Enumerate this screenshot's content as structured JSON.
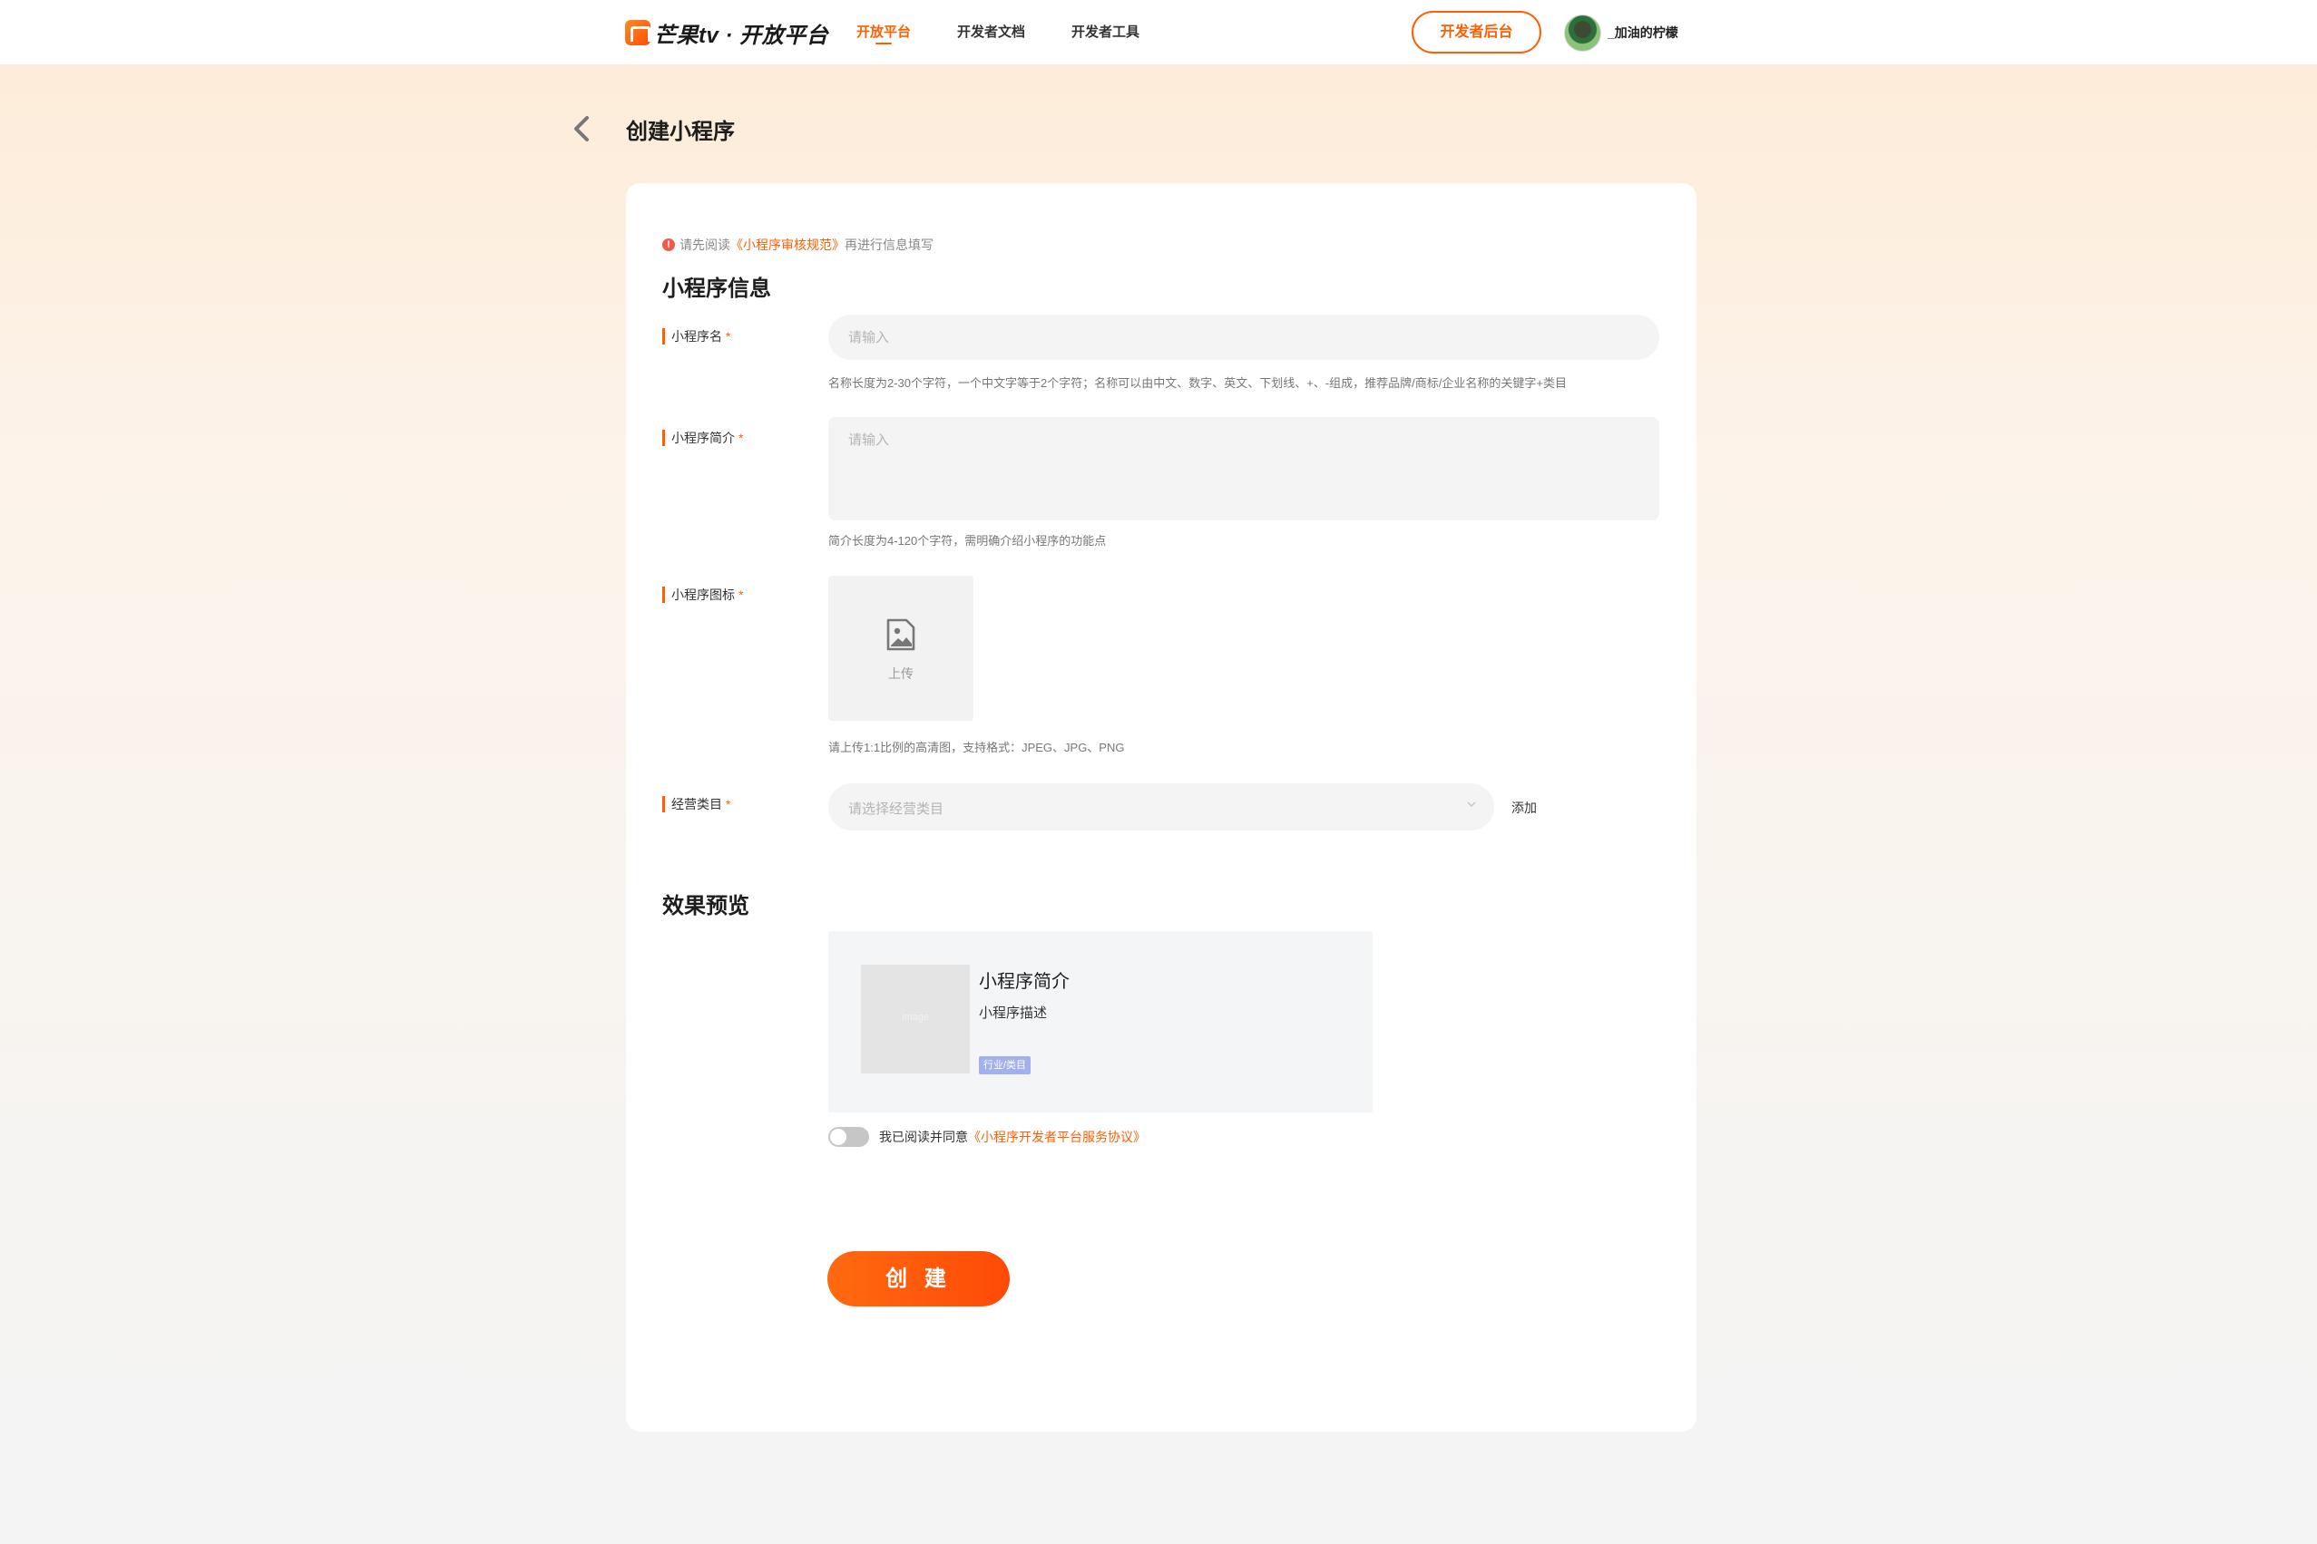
{
  "header": {
    "brand_text": "芒果tv · 开放平台",
    "nav": [
      {
        "label": "开放平台",
        "active": true
      },
      {
        "label": "开发者文档",
        "active": false
      },
      {
        "label": "开发者工具",
        "active": false
      }
    ],
    "console_button": "开发者后台",
    "username": "_加油的柠檬",
    "accent_color": "#ff5f00"
  },
  "page": {
    "title": "创建小程序",
    "back_icon": "chevron-left-icon"
  },
  "form": {
    "notice_prefix": "请先阅读",
    "notice_link": "《小程序审核规范》",
    "notice_suffix": "再进行信息填写",
    "section_info_title": "小程序信息",
    "required_mark": "*",
    "name": {
      "label": "小程序名",
      "placeholder": "请输入",
      "value": "",
      "hint": "名称长度为2-30个字符，一个中文字等于2个字符；名称可以由中文、数字、英文、下划线、+、-组成，推荐品牌/商标/企业名称的关键字+类目"
    },
    "intro": {
      "label": "小程序简介",
      "placeholder": "请输入",
      "value": "",
      "hint": "简介长度为4-120个字符，需明确介绍小程序的功能点"
    },
    "icon": {
      "label": "小程序图标",
      "upload_label": "上传",
      "hint": "请上传1:1比例的高清图，支持格式：JPEG、JPG、PNG"
    },
    "category": {
      "label": "经营类目",
      "placeholder": "请选择经营类目",
      "add_label": "添加"
    },
    "section_preview_title": "效果预览",
    "preview": {
      "thumb_text": "image",
      "title": "小程序简介",
      "description": "小程序描述",
      "tag": "行业/类目"
    },
    "agreement": {
      "checked": false,
      "text": "我已阅读并同意",
      "link": "《小程序开发者平台服务协议》"
    },
    "submit_label": "创 建"
  }
}
